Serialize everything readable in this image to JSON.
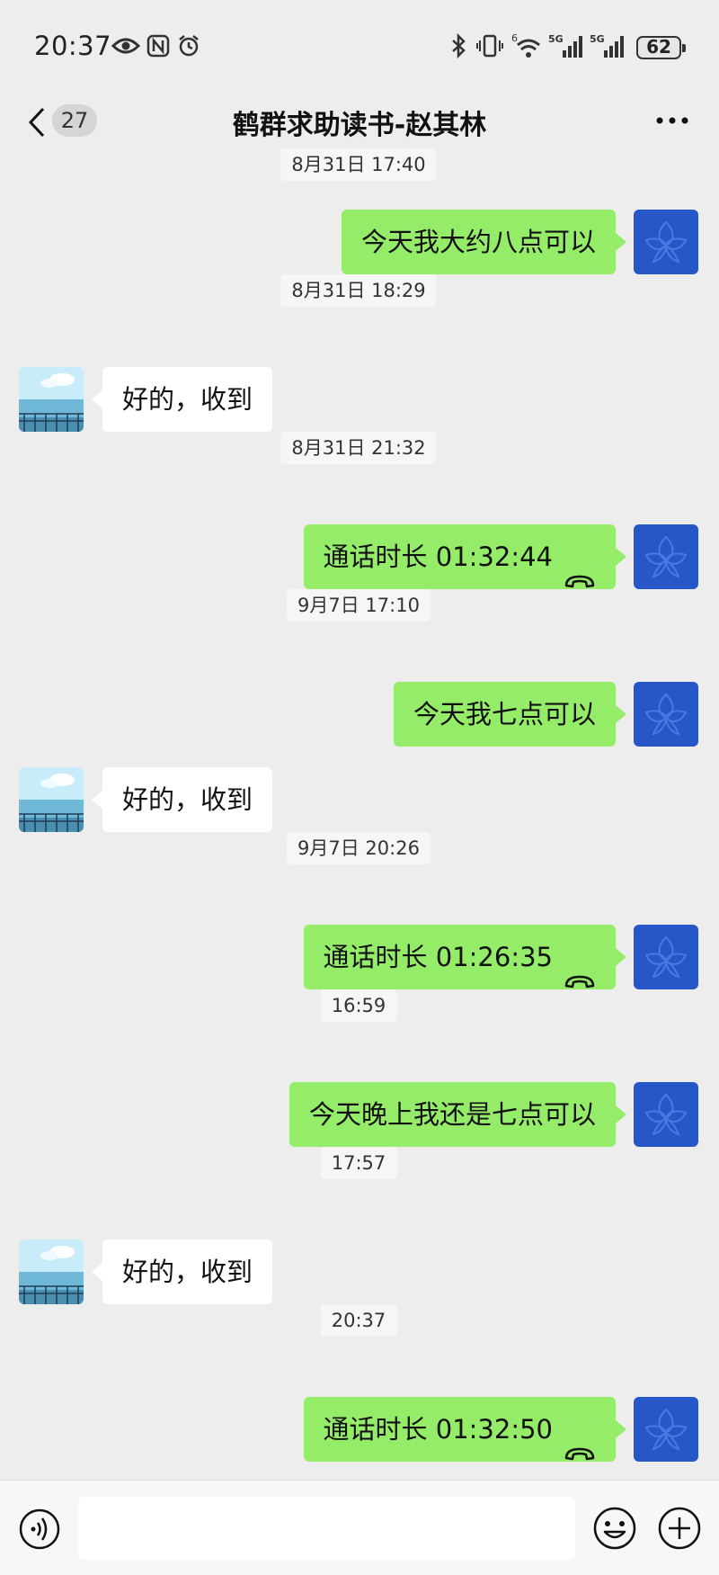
{
  "status": {
    "time": "20:37",
    "battery": "62",
    "net_label_1": "5G",
    "net_label_2": "5G",
    "wifi_label": "6"
  },
  "nav": {
    "unread_count": "27",
    "title": "鹤群求助读书-赵其林"
  },
  "messages": [
    {
      "type": "timestamp",
      "text": "8月31日 17:40"
    },
    {
      "type": "self",
      "text": "今天我大约八点可以"
    },
    {
      "type": "timestamp",
      "text": "8月31日 18:29"
    },
    {
      "type": "other",
      "text": "好的，收到"
    },
    {
      "type": "timestamp",
      "text": "8月31日 21:32"
    },
    {
      "type": "self-call",
      "text": "通话时长 01:32:44"
    },
    {
      "type": "timestamp",
      "text": "9月7日 17:10"
    },
    {
      "type": "self",
      "text": "今天我七点可以"
    },
    {
      "type": "other",
      "text": "好的，收到"
    },
    {
      "type": "timestamp",
      "text": "9月7日 20:26"
    },
    {
      "type": "self-call",
      "text": "通话时长 01:26:35"
    },
    {
      "type": "timestamp",
      "text": "16:59"
    },
    {
      "type": "self",
      "text": "今天晚上我还是七点可以"
    },
    {
      "type": "timestamp",
      "text": "17:57"
    },
    {
      "type": "other",
      "text": "好的，收到"
    },
    {
      "type": "timestamp",
      "text": "20:37"
    },
    {
      "type": "self-call",
      "text": "通话时长 01:32:50"
    }
  ],
  "input": {
    "value": "",
    "placeholder": ""
  },
  "icons": {
    "back": "chevron-left-icon",
    "more": "more-dots-icon",
    "voice": "voice-icon",
    "emoji": "emoji-icon",
    "plus": "plus-icon",
    "call": "phone-hangup-icon"
  },
  "colors": {
    "self_bubble": "#95ec69",
    "other_bubble": "#ffffff",
    "background": "#ededed",
    "self_avatar": "#2756c6"
  }
}
